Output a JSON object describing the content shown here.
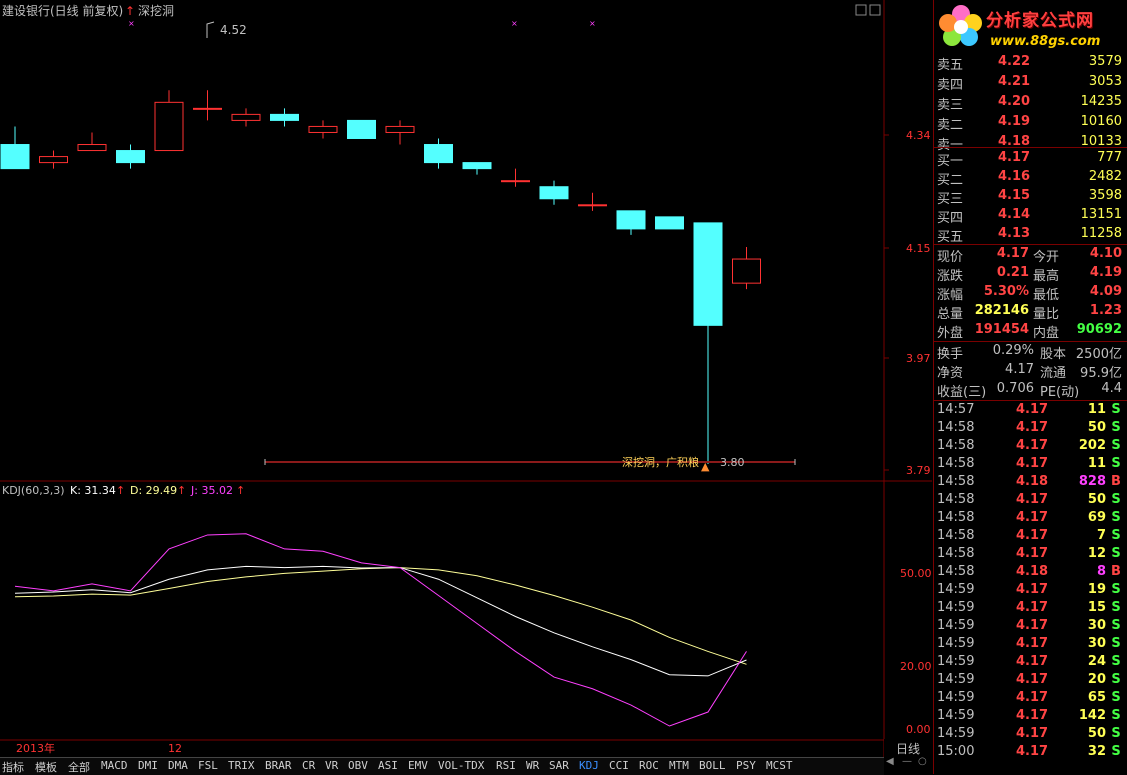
{
  "chart": {
    "title": "建设银行(日线 前复权)",
    "indicator_name": "深挖洞",
    "top_label": "4.52",
    "bottom_annotation": "深挖洞，广积粮",
    "low_label": "3.80",
    "price_axis": [
      "4.34",
      "4.15",
      "3.97",
      "3.79"
    ],
    "kdj_axis": [
      "50.00",
      "20.00",
      "0.00"
    ],
    "kdj_title": "KDJ(60,3,3)",
    "kdj_k": "K: 31.34",
    "kdj_d": "D: 29.49",
    "kdj_j": "J: 35.02",
    "date_labels": [
      "2013年",
      "12"
    ],
    "colors": {
      "up": "#ff3232",
      "down": "#54ffff",
      "k_line": "#ffffff",
      "d_line": "#ffff99",
      "j_line": "#ff40ff",
      "grid": "#7a0000"
    }
  },
  "chart_data": {
    "type": "candlestick",
    "candles": [
      {
        "o": 4.33,
        "c": 4.29,
        "h": 4.36,
        "l": 4.29
      },
      {
        "o": 4.3,
        "c": 4.31,
        "h": 4.32,
        "l": 4.29
      },
      {
        "o": 4.32,
        "c": 4.33,
        "h": 4.35,
        "l": 4.32
      },
      {
        "o": 4.32,
        "c": 4.3,
        "h": 4.33,
        "l": 4.29
      },
      {
        "o": 4.32,
        "c": 4.4,
        "h": 4.42,
        "l": 4.32
      },
      {
        "o": 4.39,
        "c": 4.39,
        "h": 4.42,
        "l": 4.37
      },
      {
        "o": 4.37,
        "c": 4.38,
        "h": 4.39,
        "l": 4.36
      },
      {
        "o": 4.38,
        "c": 4.37,
        "h": 4.39,
        "l": 4.36
      },
      {
        "o": 4.35,
        "c": 4.36,
        "h": 4.37,
        "l": 4.34
      },
      {
        "o": 4.37,
        "c": 4.34,
        "h": 4.37,
        "l": 4.34
      },
      {
        "o": 4.35,
        "c": 4.36,
        "h": 4.37,
        "l": 4.33
      },
      {
        "o": 4.33,
        "c": 4.3,
        "h": 4.34,
        "l": 4.29
      },
      {
        "o": 4.3,
        "c": 4.29,
        "h": 4.3,
        "l": 4.28
      },
      {
        "o": 4.27,
        "c": 4.27,
        "h": 4.29,
        "l": 4.26
      },
      {
        "o": 4.26,
        "c": 4.24,
        "h": 4.27,
        "l": 4.23
      },
      {
        "o": 4.23,
        "c": 4.23,
        "h": 4.25,
        "l": 4.22
      },
      {
        "o": 4.22,
        "c": 4.19,
        "h": 4.22,
        "l": 4.18
      },
      {
        "o": 4.21,
        "c": 4.19,
        "h": 4.21,
        "l": 4.19
      },
      {
        "o": 4.2,
        "c": 4.03,
        "h": 4.2,
        "l": 3.8
      },
      {
        "o": 4.1,
        "c": 4.14,
        "h": 4.16,
        "l": 4.09
      }
    ],
    "kdj": {
      "k": [
        60.0,
        60.5,
        61.5,
        60.2,
        66.0,
        70.0,
        71.5,
        71.0,
        71.5,
        70.8,
        71.0,
        66.0,
        58.0,
        50.0,
        43.0,
        37.0,
        31.5,
        25.0,
        24.5,
        31.34
      ],
      "d": [
        58.5,
        58.8,
        59.6,
        59.2,
        62.0,
        65.0,
        67.0,
        68.5,
        69.5,
        70.5,
        71.0,
        70.0,
        67.5,
        63.5,
        59.0,
        54.0,
        48.5,
        41.0,
        35.0,
        29.49
      ],
      "j": [
        63.0,
        61.0,
        64.0,
        61.0,
        79.0,
        85.0,
        85.5,
        79.0,
        78.0,
        73.0,
        71.0,
        59.0,
        47.0,
        35.0,
        24.0,
        19.0,
        12.0,
        3.0,
        9.0,
        35.02
      ]
    },
    "price_ylim": [
      3.79,
      4.52
    ],
    "kdj_ylim": [
      0,
      100
    ]
  },
  "order_book": {
    "asks": [
      {
        "label": "卖五",
        "price": "4.22",
        "vol": "3579"
      },
      {
        "label": "卖四",
        "price": "4.21",
        "vol": "3053"
      },
      {
        "label": "卖三",
        "price": "4.20",
        "vol": "14235"
      },
      {
        "label": "卖二",
        "price": "4.19",
        "vol": "10160"
      },
      {
        "label": "卖一",
        "price": "4.18",
        "vol": "10133"
      }
    ],
    "bids": [
      {
        "label": "买一",
        "price": "4.17",
        "vol": "777"
      },
      {
        "label": "买二",
        "price": "4.16",
        "vol": "2482"
      },
      {
        "label": "买三",
        "price": "4.15",
        "vol": "3598"
      },
      {
        "label": "买四",
        "price": "4.14",
        "vol": "13151"
      },
      {
        "label": "买五",
        "price": "4.13",
        "vol": "11258"
      }
    ]
  },
  "quote_info": [
    {
      "l1": "现价",
      "v1": "4.17",
      "c1": "#ff4444",
      "l2": "今开",
      "v2": "4.10",
      "c2": "#ff4444"
    },
    {
      "l1": "涨跌",
      "v1": "0.21",
      "c1": "#ff4444",
      "l2": "最高",
      "v2": "4.19",
      "c2": "#ff4444"
    },
    {
      "l1": "涨幅",
      "v1": "5.30%",
      "c1": "#ff4444",
      "l2": "最低",
      "v2": "4.09",
      "c2": "#ff4444"
    },
    {
      "l1": "总量",
      "v1": "282146",
      "c1": "#ffff55",
      "l2": "量比",
      "v2": "1.23",
      "c2": "#ff4444"
    },
    {
      "l1": "外盘",
      "v1": "191454",
      "c1": "#ff4444",
      "l2": "内盘",
      "v2": "90692",
      "c2": "#44ff44"
    }
  ],
  "fundamentals": [
    {
      "l1": "换手",
      "v1": "0.29%",
      "l2": "股本",
      "v2": "2500亿"
    },
    {
      "l1": "净资",
      "v1": "4.17",
      "l2": "流通",
      "v2": "95.9亿"
    },
    {
      "l1": "收益(三)",
      "v1": "0.706",
      "l2": "PE(动)",
      "v2": "4.4"
    }
  ],
  "ticks": [
    {
      "time": "14:57",
      "price": "4.17",
      "vol": "11",
      "bs": "S"
    },
    {
      "time": "14:58",
      "price": "4.17",
      "vol": "50",
      "bs": "S"
    },
    {
      "time": "14:58",
      "price": "4.17",
      "vol": "202",
      "bs": "S"
    },
    {
      "time": "14:58",
      "price": "4.17",
      "vol": "11",
      "bs": "S"
    },
    {
      "time": "14:58",
      "price": "4.18",
      "vol": "828",
      "bs": "B"
    },
    {
      "time": "14:58",
      "price": "4.17",
      "vol": "50",
      "bs": "S"
    },
    {
      "time": "14:58",
      "price": "4.17",
      "vol": "69",
      "bs": "S"
    },
    {
      "time": "14:58",
      "price": "4.17",
      "vol": "7",
      "bs": "S"
    },
    {
      "time": "14:58",
      "price": "4.17",
      "vol": "12",
      "bs": "S"
    },
    {
      "time": "14:58",
      "price": "4.18",
      "vol": "8",
      "bs": "B"
    },
    {
      "time": "14:59",
      "price": "4.17",
      "vol": "19",
      "bs": "S"
    },
    {
      "time": "14:59",
      "price": "4.17",
      "vol": "15",
      "bs": "S"
    },
    {
      "time": "14:59",
      "price": "4.17",
      "vol": "30",
      "bs": "S"
    },
    {
      "time": "14:59",
      "price": "4.17",
      "vol": "30",
      "bs": "S"
    },
    {
      "time": "14:59",
      "price": "4.17",
      "vol": "24",
      "bs": "S"
    },
    {
      "time": "14:59",
      "price": "4.17",
      "vol": "20",
      "bs": "S"
    },
    {
      "time": "14:59",
      "price": "4.17",
      "vol": "65",
      "bs": "S"
    },
    {
      "time": "14:59",
      "price": "4.17",
      "vol": "142",
      "bs": "S"
    },
    {
      "time": "14:59",
      "price": "4.17",
      "vol": "50",
      "bs": "S"
    },
    {
      "time": "15:00",
      "price": "4.17",
      "vol": "32",
      "bs": "S"
    }
  ],
  "logo": {
    "text": "分析家公式网",
    "url": "www.88gs.com"
  },
  "bottom_tabs": [
    "指标",
    "模板",
    "全部",
    "MACD",
    "DMI",
    "DMA",
    "FSL",
    "TRIX",
    "BRAR",
    "CR",
    "VR",
    "OBV",
    "ASI",
    "EMV",
    "VOL-TDX",
    "RSI",
    "WR",
    "SAR",
    "KDJ",
    "CCI",
    "ROC",
    "MTM",
    "BOLL",
    "PSY",
    "MCST"
  ],
  "active_tab": "KDJ",
  "period_label": "日线",
  "nav_buttons": [
    "◀",
    "—",
    "○"
  ]
}
